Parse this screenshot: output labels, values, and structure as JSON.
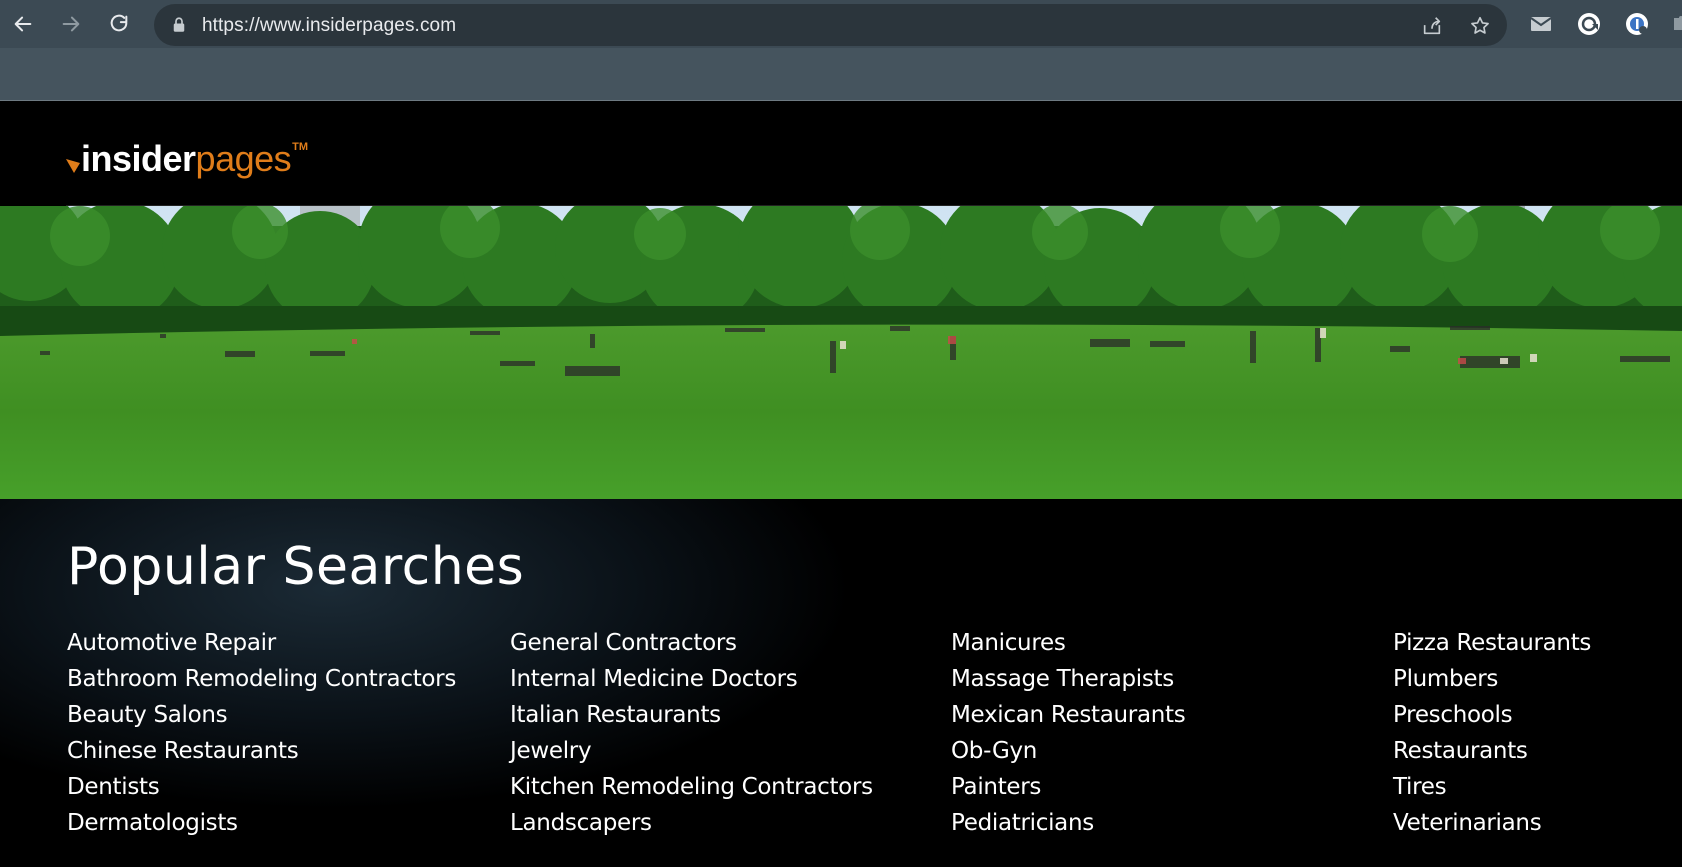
{
  "browser": {
    "url": "https://www.insiderpages.com",
    "icons": [
      "back-arrow-icon",
      "forward-arrow-icon",
      "reload-icon",
      "lock-icon",
      "share-icon",
      "star-icon",
      "mail-icon",
      "extension-icon",
      "profile-icon"
    ]
  },
  "site": {
    "logo_part1": "insider",
    "logo_part2": "pages",
    "logo_tm": "TM",
    "brand_color": "#e07d1a"
  },
  "popular": {
    "title": "Popular Searches",
    "columns": [
      [
        "Automotive Repair",
        "Bathroom Remodeling Contractors",
        "Beauty Salons",
        "Chinese Restaurants",
        "Dentists",
        "Dermatologists"
      ],
      [
        "General Contractors",
        "Internal Medicine Doctors",
        "Italian Restaurants",
        "Jewelry",
        "Kitchen Remodeling Contractors",
        "Landscapers"
      ],
      [
        "Manicures",
        "Massage Therapists",
        "Mexican Restaurants",
        "Ob-Gyn",
        "Painters",
        "Pediatricians"
      ],
      [
        "Pizza Restaurants",
        "Plumbers",
        "Preschools",
        "Restaurants",
        "Tires",
        "Veterinarians"
      ]
    ]
  }
}
